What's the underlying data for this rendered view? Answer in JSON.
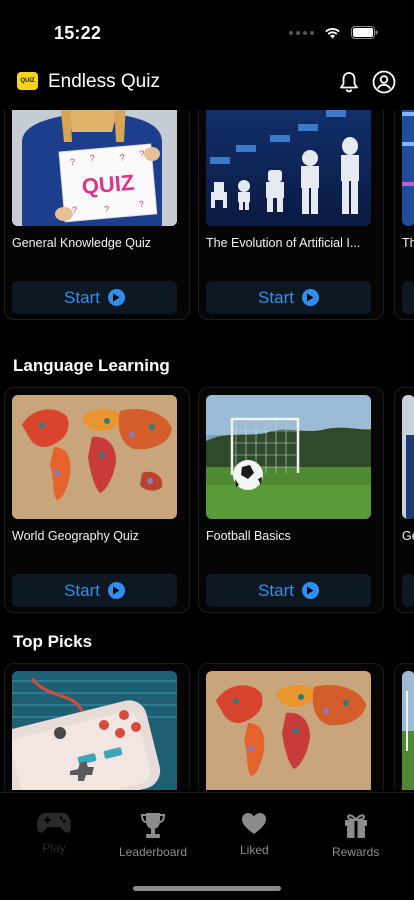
{
  "status_bar": {
    "time": "15:22"
  },
  "header": {
    "app_title": "Endless Quiz",
    "logo_text": "QUIZ"
  },
  "sections": [
    {
      "title": "",
      "cards": [
        {
          "title": "General Knowledge Quiz",
          "start_label": "Start",
          "image": "quiz-sign-photo"
        },
        {
          "title": "The Evolution of Artificial I...",
          "start_label": "Start",
          "image": "robot-evolution-illustration"
        },
        {
          "title": "Th",
          "image": "circuit-illustration"
        }
      ]
    },
    {
      "title": "Language Learning",
      "cards": [
        {
          "title": "World Geography Quiz",
          "start_label": "Start",
          "image": "world-map-photo"
        },
        {
          "title": "Football Basics",
          "start_label": "Start",
          "image": "football-field-photo"
        },
        {
          "title": "Ge",
          "image": "person-photo"
        }
      ]
    },
    {
      "title": "Top Picks",
      "cards": [
        {
          "title": "",
          "image": "game-controller-photo"
        },
        {
          "title": "",
          "image": "world-map-photo"
        },
        {
          "title": "",
          "image": "football-field-photo"
        }
      ]
    }
  ],
  "bottom_nav": [
    {
      "label": "Play",
      "icon": "gamepad-icon",
      "active": false
    },
    {
      "label": "Leaderboard",
      "icon": "trophy-icon"
    },
    {
      "label": "Liked",
      "icon": "heart-icon"
    },
    {
      "label": "Rewards",
      "icon": "gift-icon"
    }
  ],
  "colors": {
    "accent": "#2e8ff0",
    "background": "#000000",
    "logo": "#f7d31a"
  }
}
